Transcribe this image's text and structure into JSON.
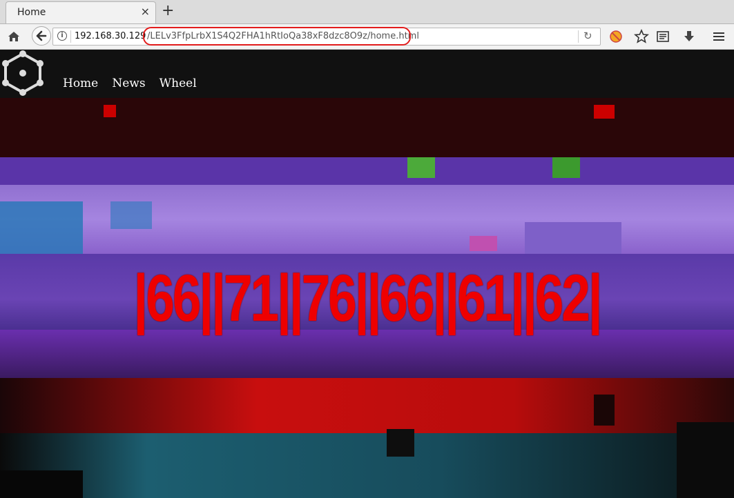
{
  "browser": {
    "tab_title": "Home",
    "tab_close": "×",
    "new_tab": "+",
    "url_host": "192.168.30.129",
    "url_path": "/LELv3FfpLrbX1S4Q2FHA1hRtIoQa38xF8dzc8O9z/home.html",
    "url_info": "i",
    "reload": "↻",
    "toolbar_icons": [
      "extension-icon",
      "bookmark-star-icon",
      "reader-icon",
      "download-icon",
      "menu-icon"
    ],
    "highlight_color": "#e21b1b"
  },
  "site": {
    "nav": [
      "Home",
      "News",
      "Wheel"
    ],
    "codes": "|66||71||76||66||61||62|",
    "code_color": "#ee0000",
    "colors": {
      "header_bg": "#111111",
      "dark_red": "#2a0608",
      "purple": "#6e40b8",
      "lavender": "#9a78d8",
      "red": "#c80e0e",
      "teal": "#1c5e70"
    }
  }
}
